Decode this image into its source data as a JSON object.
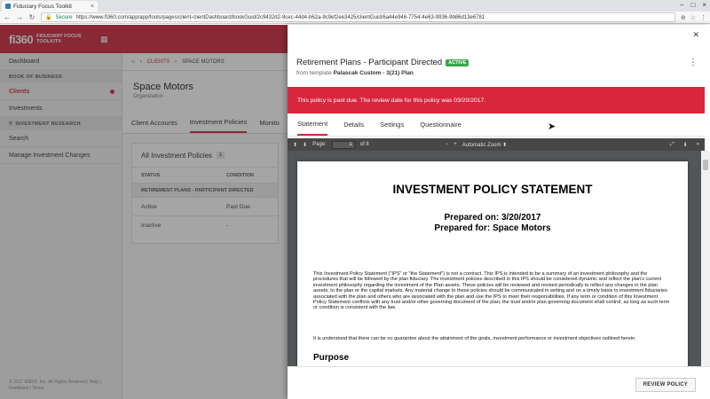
{
  "browser": {
    "tab_title": "Fiduciary Focus Toolkit",
    "secure_label": "Secure",
    "url": "https://www.fi360.com/app/app/tools/pages/client-clientDashboard/bookGuid/2c9432d2-9cec-44d4-b62a-9c9ef2ee3425/clientGuid/6a44e946-7754-4e63-9936-9b86d13e6781"
  },
  "app": {
    "logo": "fi360",
    "logo_sub": "FIDUCIARY FOCUS TOOLKIT®",
    "sidebar": {
      "dashboard": "Dashboard",
      "book_section": "BOOK OF BUSINESS",
      "clients": "Clients",
      "investments": "Investments",
      "research_section": "INVESTMENT RESEARCH",
      "search": "Search",
      "manage_changes": "Manage Investment Changes",
      "footer": "© 2017 fi360®, Inc. All Rights Reserved. Help | Feedback | Terms"
    },
    "breadcrumb": {
      "clients": "CLIENTS",
      "current": "SPACE MOTORS"
    },
    "client": {
      "name": "Space Motors",
      "type": "Organization"
    },
    "tabs": [
      "Client Accounts",
      "Investment Policies",
      "Monito"
    ],
    "policies_card": {
      "title": "All Investment Policies",
      "count": "1",
      "col_status": "STATUS",
      "col_condition": "CONDITION",
      "group": "RETIREMENT PLANS - PARTICIPANT DIRECTED",
      "rows": [
        {
          "status": "Active",
          "condition": "Past Due"
        },
        {
          "status": "Inactive",
          "condition": "-"
        }
      ]
    }
  },
  "drawer": {
    "title": "Retirement Plans - Participant Directed",
    "badge": "ACTIVE",
    "template_prefix": "from template",
    "template_name": "Palascak Custom - 3(21) Plan",
    "alert": "This policy is past due. The review date for this policy was 03/20/2017.",
    "tabs": [
      "Statement",
      "Details",
      "Settings",
      "Questionnaire"
    ],
    "pdf": {
      "page_label": "Page:",
      "page_value": "1",
      "page_total": "of 8",
      "zoom": "Automatic Zoom",
      "doc_title": "INVESTMENT POLICY STATEMENT",
      "prepared_on": "Prepared on:  3/20/2017",
      "prepared_for": "Prepared for: Space Motors",
      "para1": "This Investment Policy Statement (\"IPS\" or \"the Statement\") is not a contract. This IPS is intended to be a summary of an investment philosophy and the procedures that will be followed by the plan fiduciary. The investment policies described in this IPS should be considered dynamic and reflect the plan's current investment philosophy regarding the investment of the Plan assets. These policies will be reviewed and revised periodically to reflect any changes in the plan assets, to the plan or the capital markets. Any material change to these policies should be communicated in writing and on a timely basis to investment fiduciaries associated with the plan and others who are associated with the plan and use the IPS to meet their responsibilities. If any term or condition of this Investment Policy Statement conflicts with any trust and/or other governing document of the plan, the trust and/or plan governing document shall control, as long as such term or condition is consistent with the law.",
      "para2": "It is understood that there can be no guarantee about the attainment of the goals, investment performance or investment objectives outlined herein.",
      "heading": "Purpose"
    },
    "review_button": "REVIEW POLICY"
  }
}
